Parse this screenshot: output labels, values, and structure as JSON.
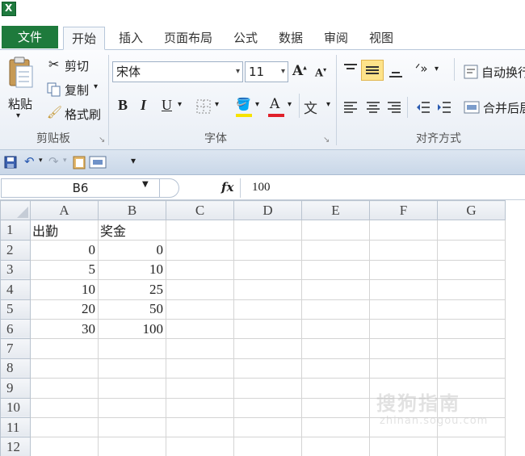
{
  "tabs": [
    "文件",
    "开始",
    "插入",
    "页面布局",
    "公式",
    "数据",
    "审阅",
    "视图"
  ],
  "clipboard": {
    "paste": "粘贴",
    "cut": "剪切",
    "copy": "复制",
    "format_painter": "格式刷",
    "label": "剪贴板"
  },
  "font": {
    "name": "宋体",
    "size": "11",
    "bold": "B",
    "italic": "I",
    "underline": "U",
    "label": "字体"
  },
  "alignment": {
    "wrap_text": "自动换行",
    "merge": "合并后居中",
    "label": "对齐方式"
  },
  "formula_bar": {
    "name_box": "B6",
    "fx": "fx",
    "value": "100"
  },
  "columns": [
    "A",
    "B",
    "C",
    "D",
    "E",
    "F",
    "G"
  ],
  "rows": [
    {
      "n": "1",
      "a": "出勤",
      "b": "奖金"
    },
    {
      "n": "2",
      "a": "0",
      "b": "0"
    },
    {
      "n": "3",
      "a": "5",
      "b": "10"
    },
    {
      "n": "4",
      "a": "10",
      "b": "25"
    },
    {
      "n": "5",
      "a": "20",
      "b": "50"
    },
    {
      "n": "6",
      "a": "30",
      "b": "100"
    },
    {
      "n": "7",
      "a": "",
      "b": ""
    },
    {
      "n": "8",
      "a": "",
      "b": ""
    },
    {
      "n": "9",
      "a": "",
      "b": ""
    },
    {
      "n": "10",
      "a": "",
      "b": ""
    },
    {
      "n": "11",
      "a": "",
      "b": ""
    },
    {
      "n": "12",
      "a": "",
      "b": ""
    }
  ],
  "watermark": {
    "main": "搜狗指南",
    "sub": "zhinan.sogou.com"
  },
  "colors": {
    "file_tab": "#1e7a3c",
    "accent_highlight": "#fde38a",
    "font_color_bar": "#e0202a",
    "fill_color_bar": "#f7e300"
  }
}
